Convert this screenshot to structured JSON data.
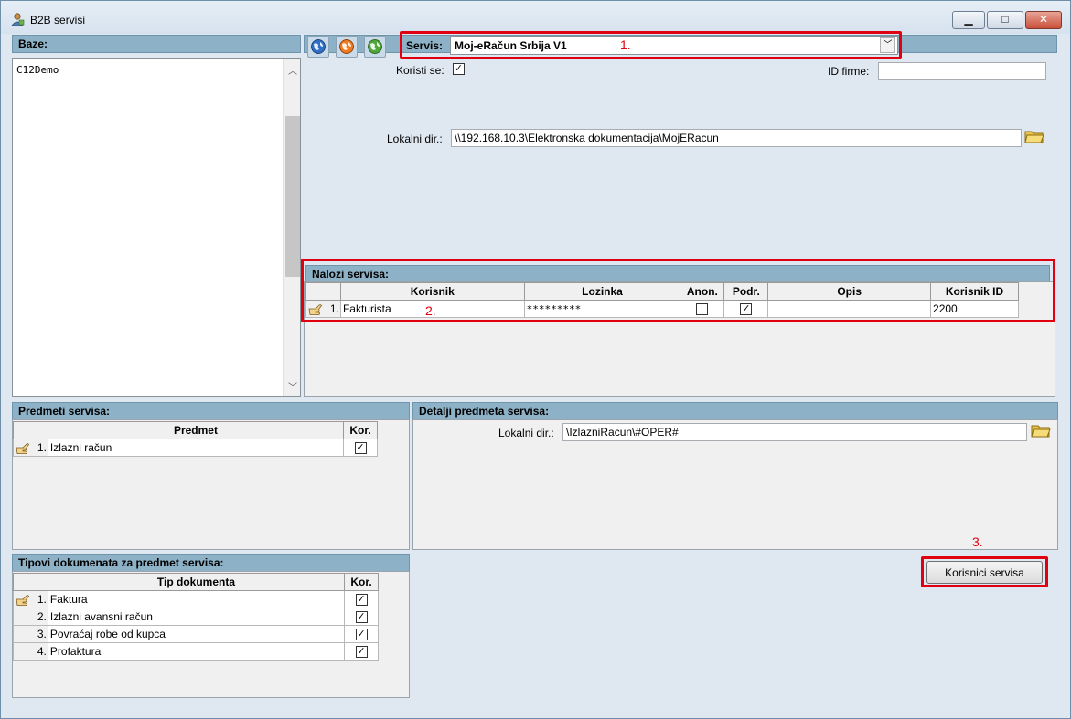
{
  "window": {
    "title": "B2B servisi",
    "icon": "b2b-app-icon"
  },
  "baze": {
    "header": "Baze:",
    "items": [
      "C12Demo"
    ]
  },
  "toolbar": {
    "icons": [
      "globe-blue-icon",
      "globe-orange-icon",
      "globe-green-icon"
    ]
  },
  "servis": {
    "label": "Servis:",
    "value": "Moj-eRačun Srbija V1",
    "annotation": "1."
  },
  "koristi_se": {
    "label": "Koristi se:",
    "checked": true
  },
  "id_firme": {
    "label": "ID firme:",
    "value": ""
  },
  "lokalni_dir": {
    "label": "Lokalni dir.:",
    "value": "\\\\192.168.10.3\\Elektronska dokumentacija\\MojERacun"
  },
  "nalozi": {
    "header": "Nalozi servisa:",
    "columns": [
      "Korisnik",
      "Lozinka",
      "Anon.",
      "Podr.",
      "Opis",
      "Korisnik ID"
    ],
    "rows": [
      {
        "num": "1.",
        "korisnik": "Fakturista",
        "lozinka": "*********",
        "anon": false,
        "podr": true,
        "opis": "",
        "korisnik_id": "2200"
      }
    ],
    "annotation": "2."
  },
  "predmeti": {
    "header": "Predmeti servisa:",
    "columns": [
      "Predmet",
      "Kor."
    ],
    "rows": [
      {
        "num": "1.",
        "predmet": "Izlazni račun",
        "kor": true
      }
    ]
  },
  "detalji": {
    "header": "Detalji predmeta servisa:",
    "lokalni_dir_label": "Lokalni dir.:",
    "lokalni_dir_value": "\\IzlazniRacun\\#OPER#"
  },
  "tipovi": {
    "header": "Tipovi dokumenata za predmet servisa:",
    "columns": [
      "Tip dokumenta",
      "Kor."
    ],
    "rows": [
      {
        "num": "1.",
        "tip": "Faktura",
        "kor": true
      },
      {
        "num": "2.",
        "tip": "Izlazni avansni račun",
        "kor": true
      },
      {
        "num": "3.",
        "tip": "Povraćaj robe od kupca",
        "kor": true
      },
      {
        "num": "4.",
        "tip": "Profaktura",
        "kor": true
      }
    ]
  },
  "korisnici_button": {
    "label": "Korisnici servisa",
    "annotation": "3."
  },
  "colors": {
    "band": "#8db1c6",
    "annotation_red": "#e1000f"
  }
}
